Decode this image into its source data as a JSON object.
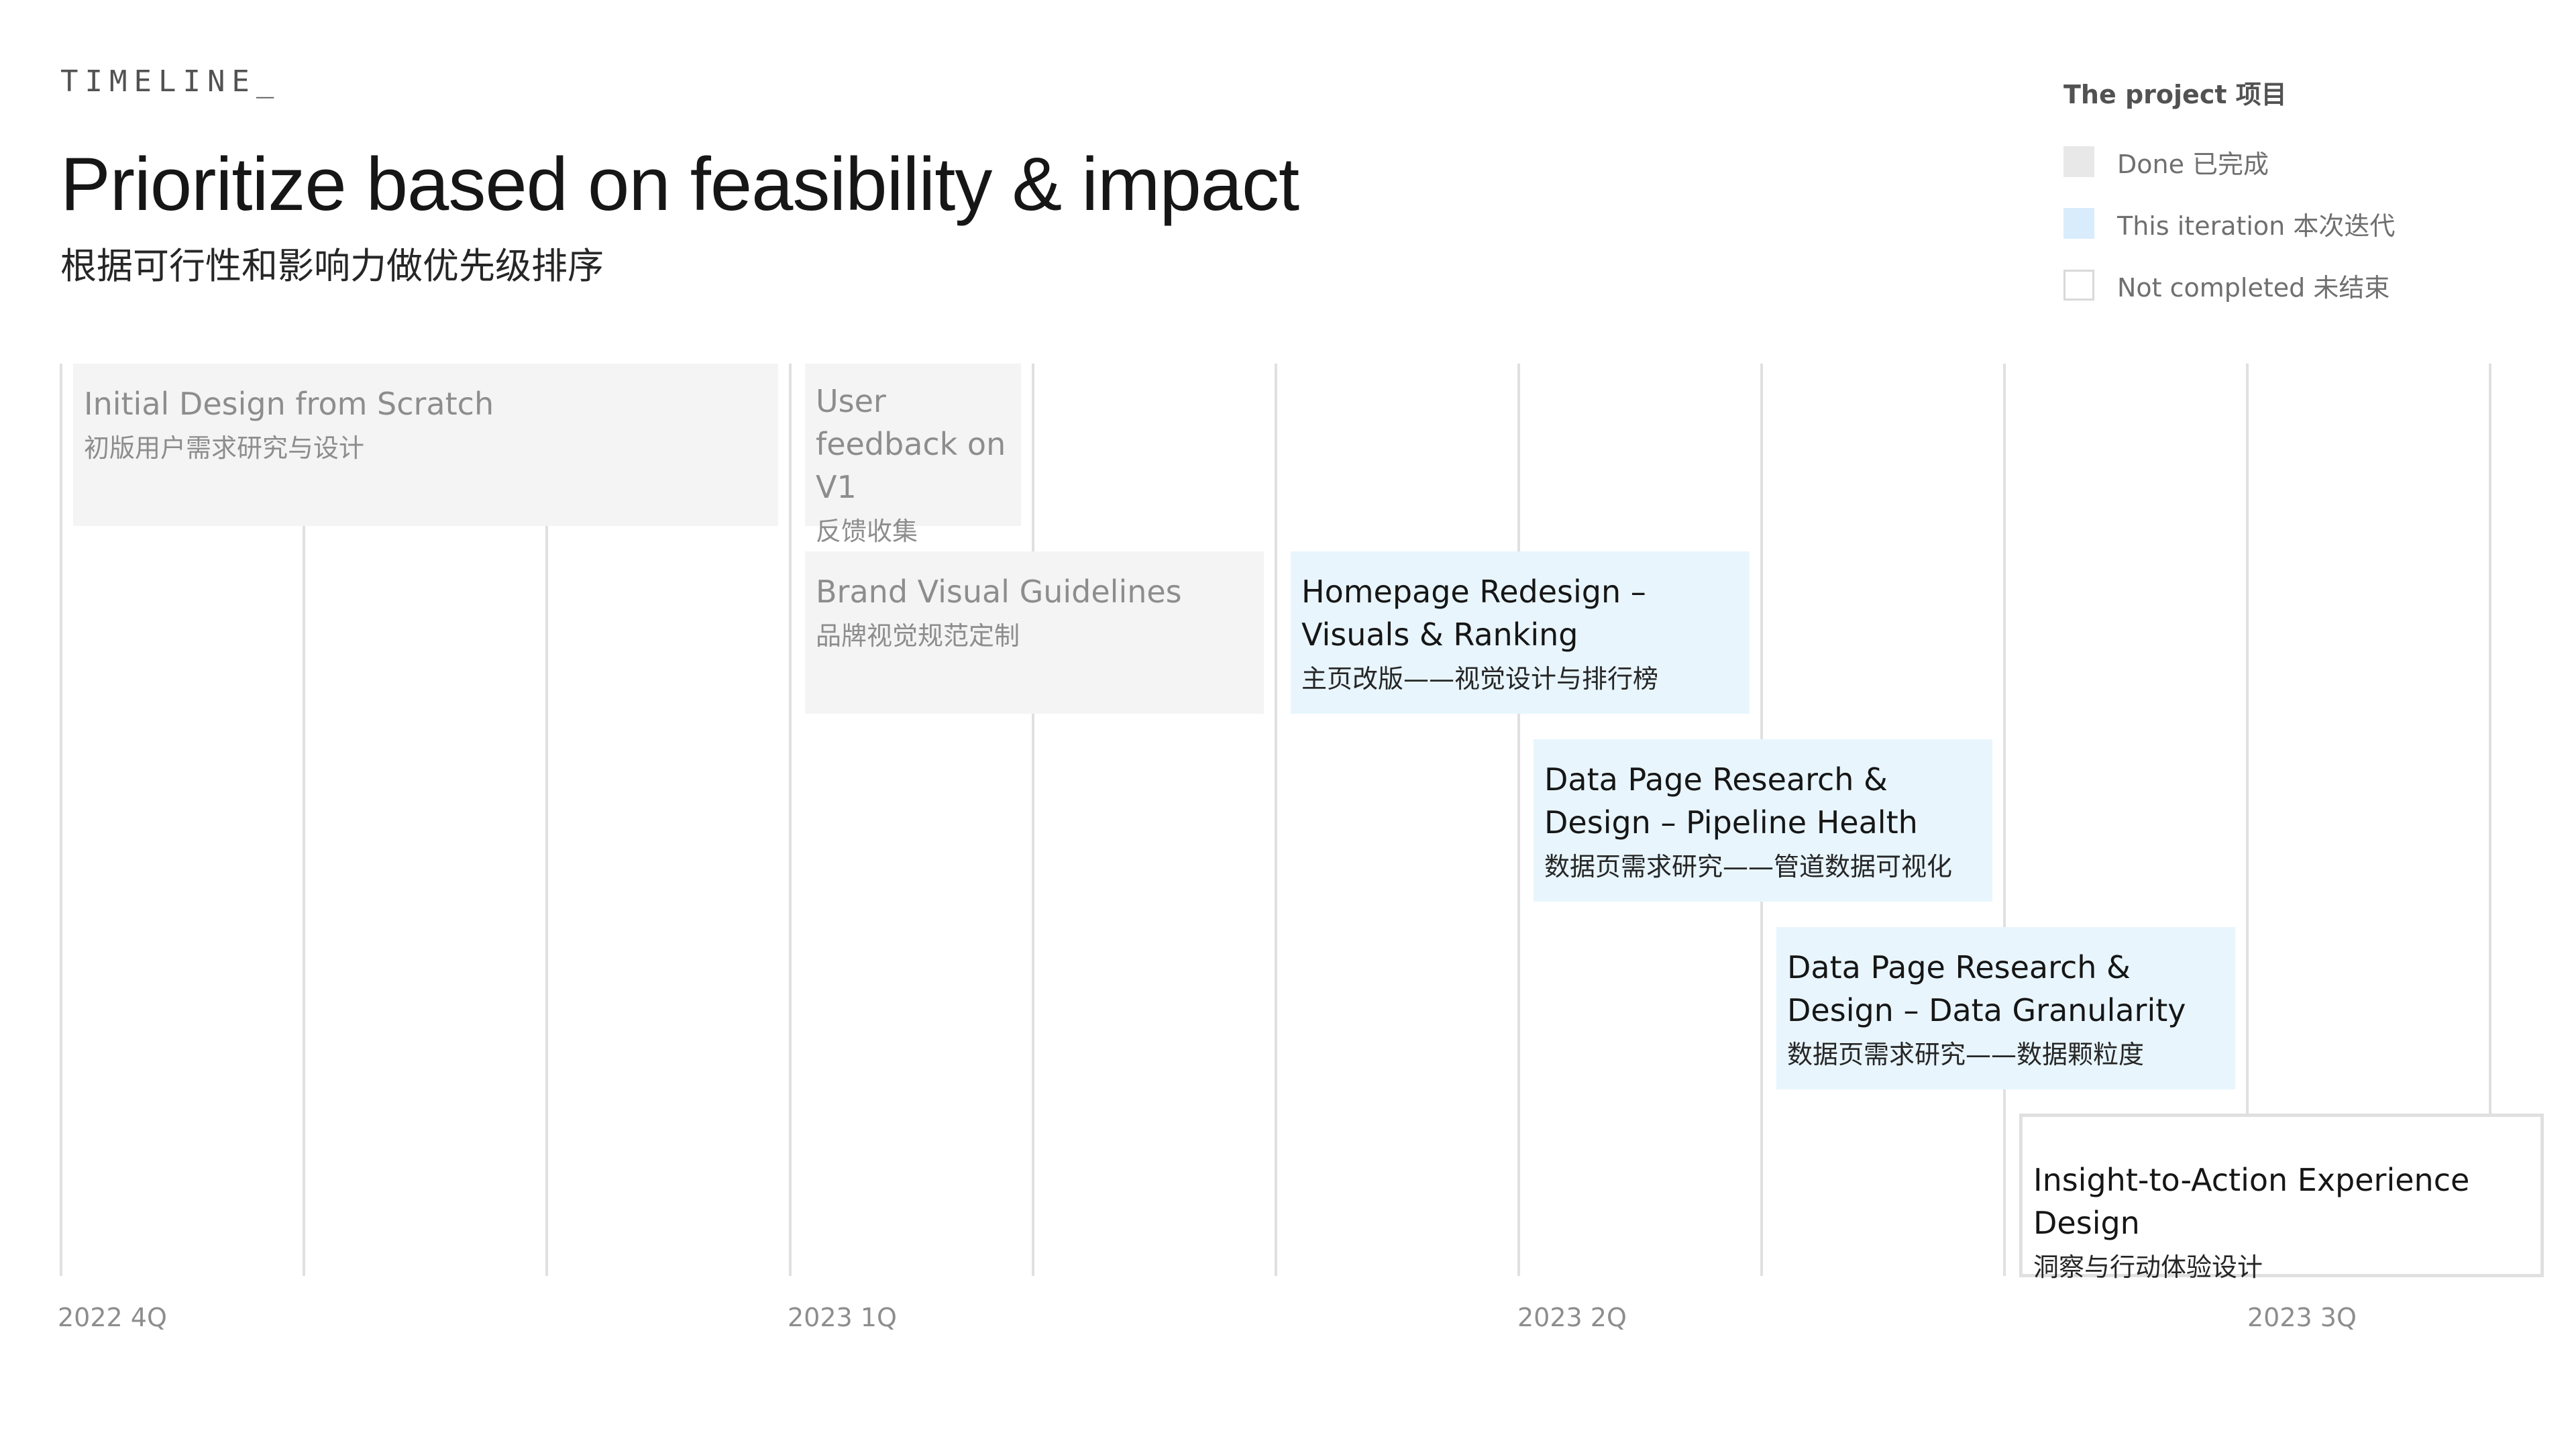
{
  "header": {
    "eyebrow": "TIMELINE_",
    "title": "Prioritize based on feasibility & impact",
    "subtitle": "根据可行性和影响力做优先级排序"
  },
  "legend": {
    "title": "The project 项目",
    "items": [
      {
        "label": "Done 已完成",
        "status": "done"
      },
      {
        "label": "This iteration 本次迭代",
        "status": "iteration"
      },
      {
        "label": "Not completed 未结束",
        "status": "open"
      }
    ]
  },
  "timeline": {
    "quarters": [
      "2022 4Q",
      "2023 1Q",
      "2023 2Q",
      "2023 3Q"
    ],
    "tasks": [
      {
        "title": "Initial Design from Scratch",
        "subtitle": "初版用户需求研究与设计",
        "status": "done"
      },
      {
        "title": "User feedback on V1",
        "subtitle": "反馈收集",
        "status": "done"
      },
      {
        "title": "Brand Visual Guidelines",
        "subtitle": "品牌视觉规范定制",
        "status": "done"
      },
      {
        "title": "Homepage Redesign – Visuals & Ranking",
        "subtitle": "主页改版——视觉设计与排行榜",
        "status": "iteration"
      },
      {
        "title": "Data Page Research & Design – Pipeline Health",
        "subtitle": "数据页需求研究——管道数据可视化",
        "status": "iteration"
      },
      {
        "title": "Data Page Research & Design – Data Granularity",
        "subtitle": "数据页需求研究——数据颗粒度",
        "status": "iteration"
      },
      {
        "title": "Insight-to-Action Experience Design",
        "subtitle": "洞察与行动体验设计",
        "status": "open"
      }
    ]
  },
  "colors": {
    "done_fill": "#f4f4f4",
    "iteration_fill": "#e8f5fd",
    "open_border": "#e0e0e0",
    "gridline": "#e0e0e0"
  }
}
